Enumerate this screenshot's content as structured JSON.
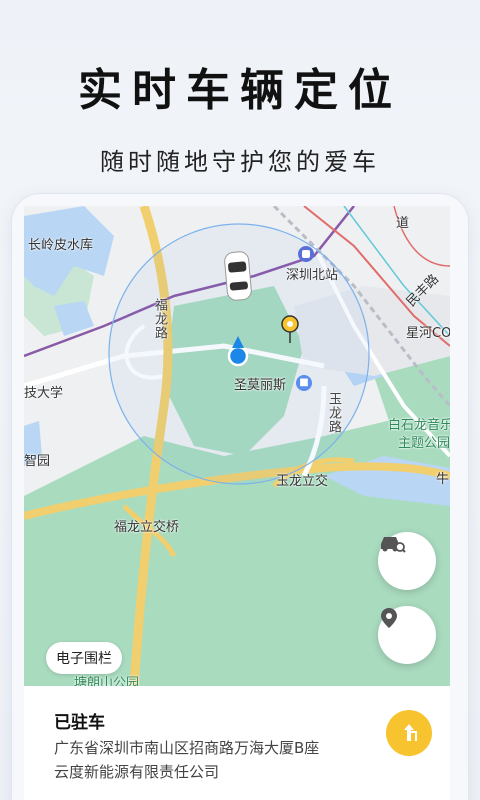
{
  "header": {
    "title": "实时车辆定位",
    "subtitle": "随时随地守护您的爱车"
  },
  "map": {
    "labels": {
      "changlingpi": "长岭皮水库",
      "shenzhen_north": "深圳北站",
      "fulong_road": "福龙路",
      "shengmolisi": "圣莫丽斯",
      "yulong_road": "玉龙路",
      "minle_road": "民丰路",
      "xinghe": "星河CO",
      "baishilong": "白石龙音乐",
      "theme_park": "主题公园",
      "university": "技大学",
      "zhiyuan": "智园",
      "yulong_bridge": "玉龙立交",
      "fulong_bridge": "福龙立交桥",
      "park_bottom": "塘朗山公园",
      "road_niu": "牛",
      "road_dao": "道"
    },
    "colors": {
      "water": "#b9d6f5",
      "green": "#a9dbbf",
      "road_main": "#f2cf6e",
      "metro": "#8a5aa8",
      "accent_blue": "#1b87e8"
    }
  },
  "controls": {
    "fence_label": "电子围栏",
    "car_search_icon": "car-search-icon",
    "location_icon": "map-pin-icon"
  },
  "card": {
    "status": "已驻车",
    "address_line1": "广东省深圳市南山区招商路万海大厦B座",
    "address_line2": "云度新能源有限责任公司",
    "nav_icon": "navigate-icon",
    "nav_color": "#f7c32e"
  }
}
